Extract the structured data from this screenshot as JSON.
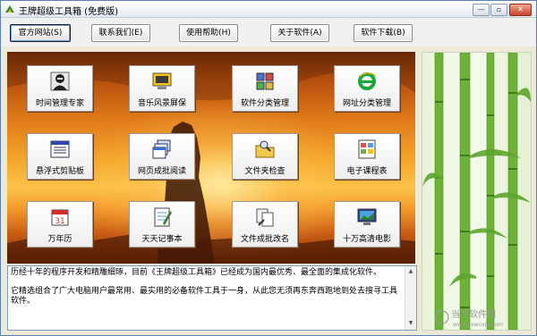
{
  "window": {
    "title": "王牌超级工具箱 (免费版)",
    "controls": {
      "minimize": "—",
      "maximize": "▫",
      "close": "✕"
    }
  },
  "toolbar": {
    "buttons": [
      {
        "label": "官方网站(S)",
        "active": true
      },
      {
        "label": "联系我们(E)",
        "active": false
      },
      {
        "label": "使用帮助(H)",
        "active": false
      },
      {
        "label": "关于软件(A)",
        "active": false
      },
      {
        "label": "软件下载(B)",
        "active": false
      }
    ]
  },
  "apps": [
    {
      "label": "时间管理专家",
      "icon": "person-icon"
    },
    {
      "label": "音乐风景屏保",
      "icon": "monitor-icon"
    },
    {
      "label": "软件分类管理",
      "icon": "software-manager-icon"
    },
    {
      "label": "网址分类管理",
      "icon": "ie-icon"
    },
    {
      "label": "悬浮式剪贴板",
      "icon": "clipboard-window-icon"
    },
    {
      "label": "网页成批阅读",
      "icon": "web-pages-icon"
    },
    {
      "label": "文件夹检查",
      "icon": "folder-search-icon"
    },
    {
      "label": "电子课程表",
      "icon": "schedule-icon"
    },
    {
      "label": "万年历",
      "icon": "calendar-icon"
    },
    {
      "label": "天天记事本",
      "icon": "notebook-icon"
    },
    {
      "label": "文件成批改名",
      "icon": "rename-files-icon"
    },
    {
      "label": "十万高清电影",
      "icon": "movie-monitor-icon"
    }
  ],
  "calendar_day": "31",
  "info": {
    "line1": "历经十年的程序开发和精雕细琢，目前《王牌超级工具箱》已经成为国内最优秀、最全面的集成化软件。",
    "line2": "它精选组合了广大电脑用户最常用、最实用的必备软件工具于一身，从此您无须再东奔西跑地到处去搜寻工具软件。"
  },
  "watermark": {
    "name": "当下软件园",
    "url": "www.downxia.com"
  }
}
